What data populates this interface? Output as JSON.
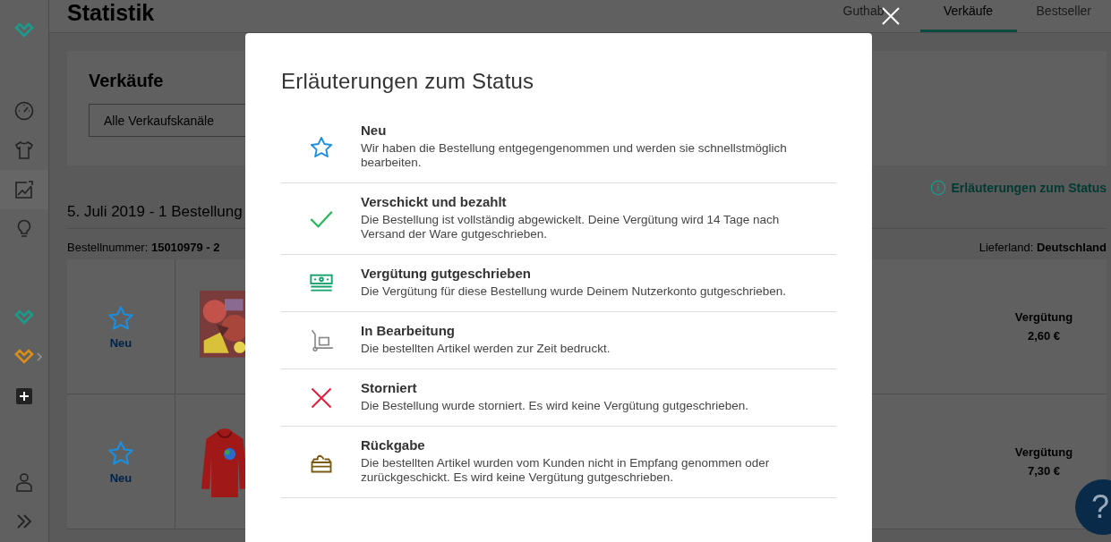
{
  "page": {
    "title": "Statistik",
    "tabs": [
      {
        "label": "Guthab",
        "selected": false
      },
      {
        "label": "Verkäufe",
        "selected": true
      },
      {
        "label": "Bestseller",
        "selected": false
      }
    ],
    "section_title": "Verkäufe",
    "channel_select": {
      "value": "Alle Verkaufskanäle"
    },
    "info_link": "Erläuterungen zum Status",
    "date_heading": "5. Juli 2019 - 1 Bestellung",
    "order": {
      "number_label": "Bestellnummer:",
      "number": "15010979 - 2",
      "country_label": "Lieferland:",
      "country": "Deutschland"
    },
    "items": [
      {
        "status": "Neu",
        "kind": "star",
        "payout_label": "Vergütung",
        "payout": "2,60 €"
      },
      {
        "status": "Neu",
        "kind": "star",
        "payout_label": "Vergütung",
        "payout": "7,30 €"
      }
    ],
    "help_button": "?"
  },
  "dialog": {
    "title": "Erläuterungen zum Status",
    "statuses": [
      {
        "kind": "star",
        "title": "Neu",
        "text": "Wir haben die Bestellung entgegengenommen und werden sie schnellstmöglich bearbeiten."
      },
      {
        "kind": "check",
        "title": "Verschickt und bezahlt",
        "text": "Die Bestellung ist vollständig abgewickelt. Deine Vergütung wird 14 Tage nach Versand der Ware gutgeschrieben."
      },
      {
        "kind": "money",
        "title": "Vergütung gutgeschrieben",
        "text": "Die Vergütung für diese Bestellung wurde Deinem Nutzerkonto gutgeschrieben."
      },
      {
        "kind": "cart",
        "title": "In Bearbeitung",
        "text": "Die bestellten Artikel werden zur Zeit bedruckt."
      },
      {
        "kind": "cross",
        "title": "Storniert",
        "text": "Die Bestellung wurde storniert. Es wird keine Vergütung gutgeschrieben."
      },
      {
        "kind": "return",
        "title": "Rückgabe",
        "text": "Die bestellten Artikel wurden vom Kunden nicht in Empfang genommen oder zurückgeschickt. Es wird keine Vergütung gutgeschrieben."
      }
    ]
  }
}
